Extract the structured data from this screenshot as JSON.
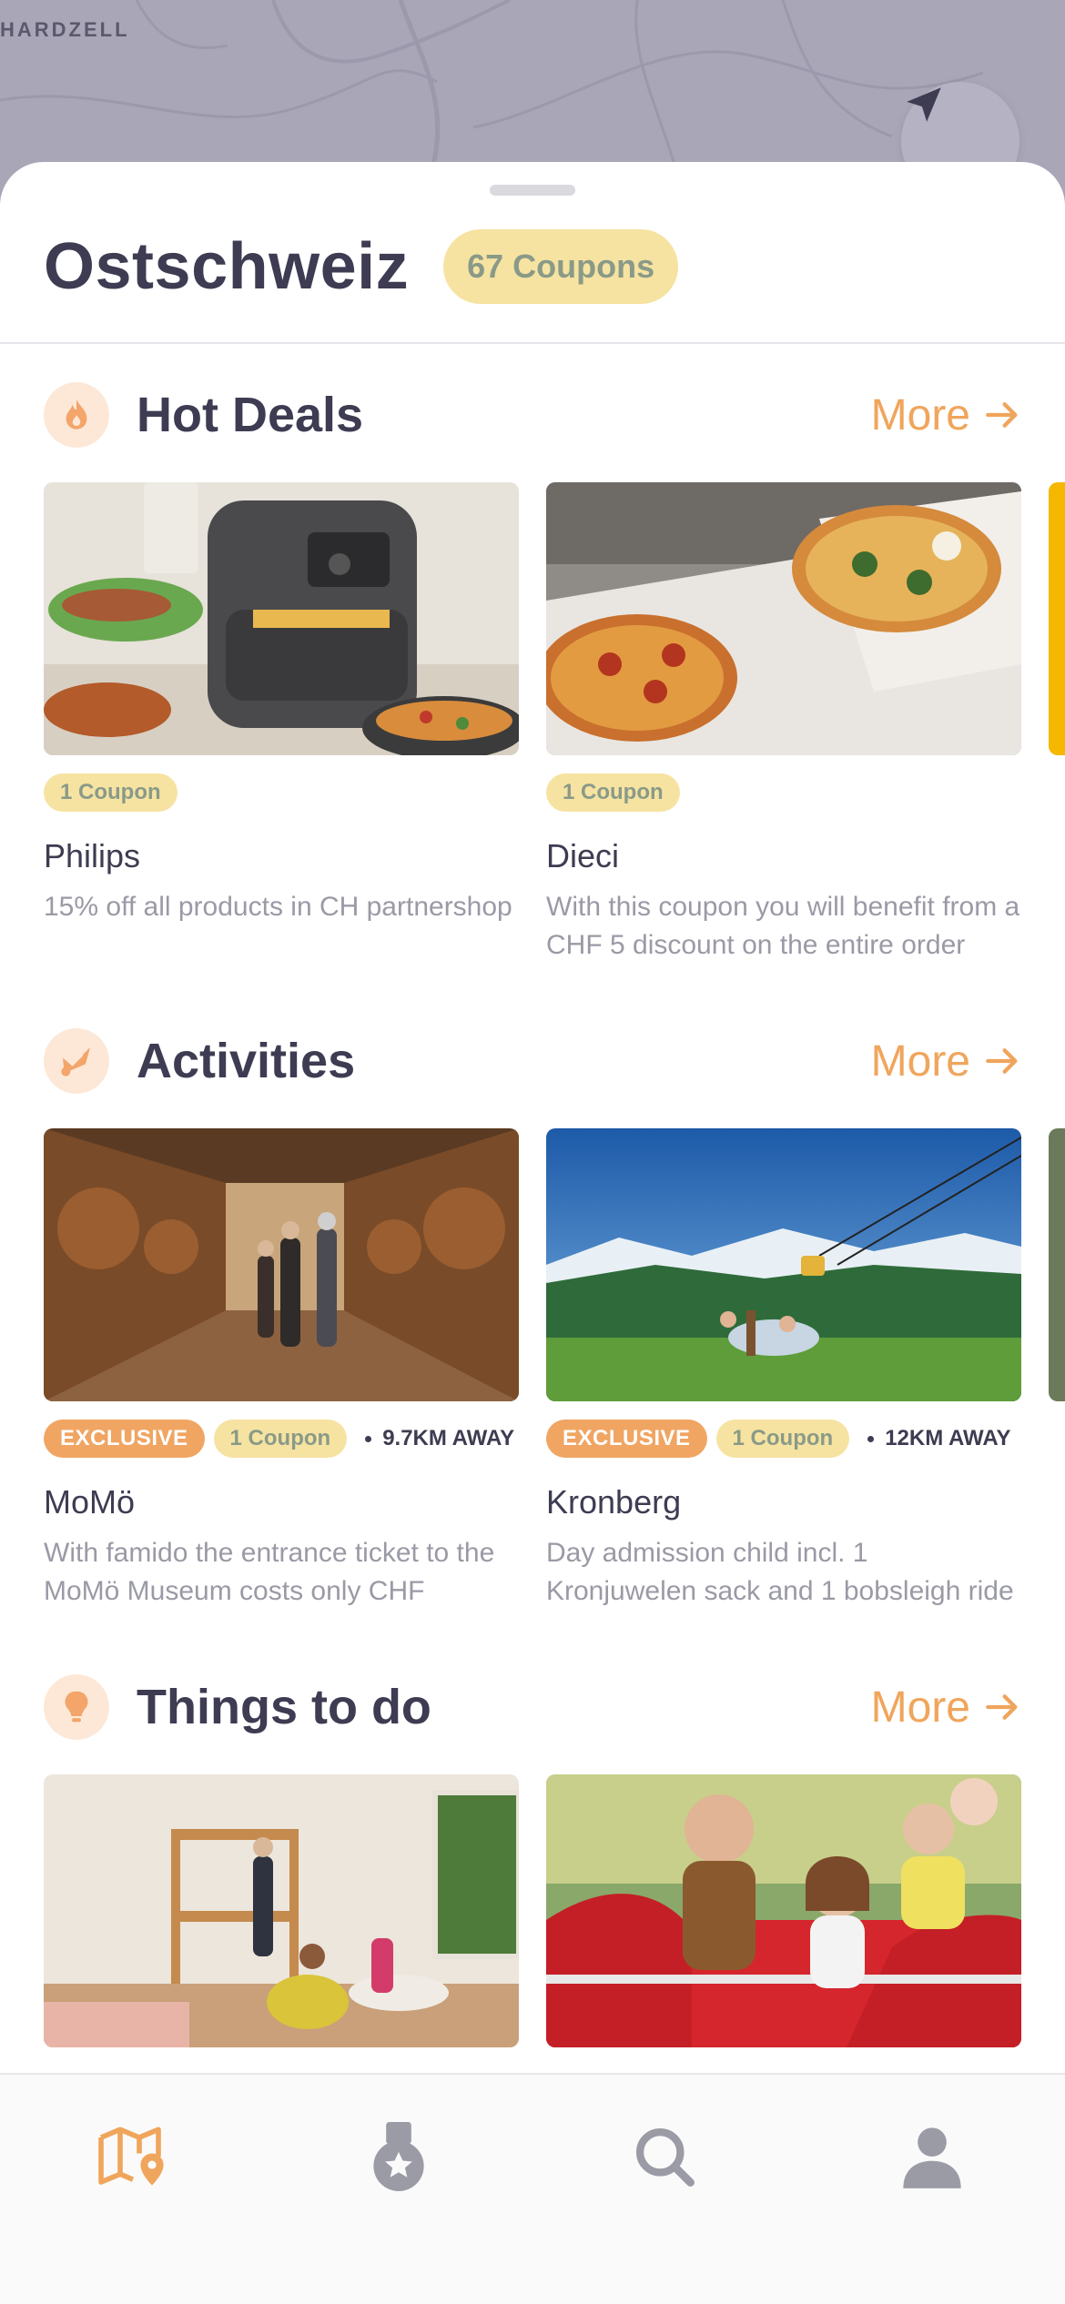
{
  "map": {
    "label": "HARDZELL"
  },
  "region": {
    "title": "Ostschweiz",
    "coupons": "67 Coupons"
  },
  "sections": [
    {
      "title": "Hot Deals",
      "more": "More",
      "icon": "flame-icon",
      "cards": [
        {
          "tag_coupon": "1 Coupon",
          "name": "Philips",
          "desc": "15% off all products in CH partnershop",
          "image": "air-fryer-image"
        },
        {
          "tag_coupon": "1 Coupon",
          "name": "Dieci",
          "desc": "With this coupon you will benefit from a CHF 5 discount on the entire order",
          "image": "pizza-image"
        }
      ]
    },
    {
      "title": "Activities",
      "more": "More",
      "icon": "shuttlecock-icon",
      "cards": [
        {
          "tag_exclusive": "EXCLUSIVE",
          "tag_coupon": "1 Coupon",
          "distance": "9.7KM AWAY",
          "name": "MoMö",
          "desc": "With famido the entrance ticket to the MoMö Museum costs only CHF",
          "image": "wine-cellar-image"
        },
        {
          "tag_exclusive": "EXCLUSIVE",
          "tag_coupon": "1 Coupon",
          "distance": "12KM AWAY",
          "name": "Kronberg",
          "desc": "Day admission child incl. 1 Kronjuwelen sack and 1 bobsleigh ride",
          "image": "zipline-image"
        }
      ]
    },
    {
      "title": "Things to do",
      "more": "More",
      "icon": "lightbulb-icon",
      "cards": [
        {
          "image": "hostel-room-image"
        },
        {
          "image": "amusement-ride-image"
        }
      ]
    }
  ],
  "colors": {
    "accent": "#f0a55c",
    "pill": "#f6e3a1",
    "pill_text": "#8a9a88",
    "title": "#3d3c52",
    "muted": "#9a9aa6"
  },
  "tabbar": {
    "items": [
      {
        "name": "map-tab",
        "icon": "map-pin-icon",
        "active": true
      },
      {
        "name": "rewards-tab",
        "icon": "medal-icon",
        "active": false
      },
      {
        "name": "search-tab",
        "icon": "search-icon",
        "active": false
      },
      {
        "name": "profile-tab",
        "icon": "user-icon",
        "active": false
      }
    ]
  }
}
